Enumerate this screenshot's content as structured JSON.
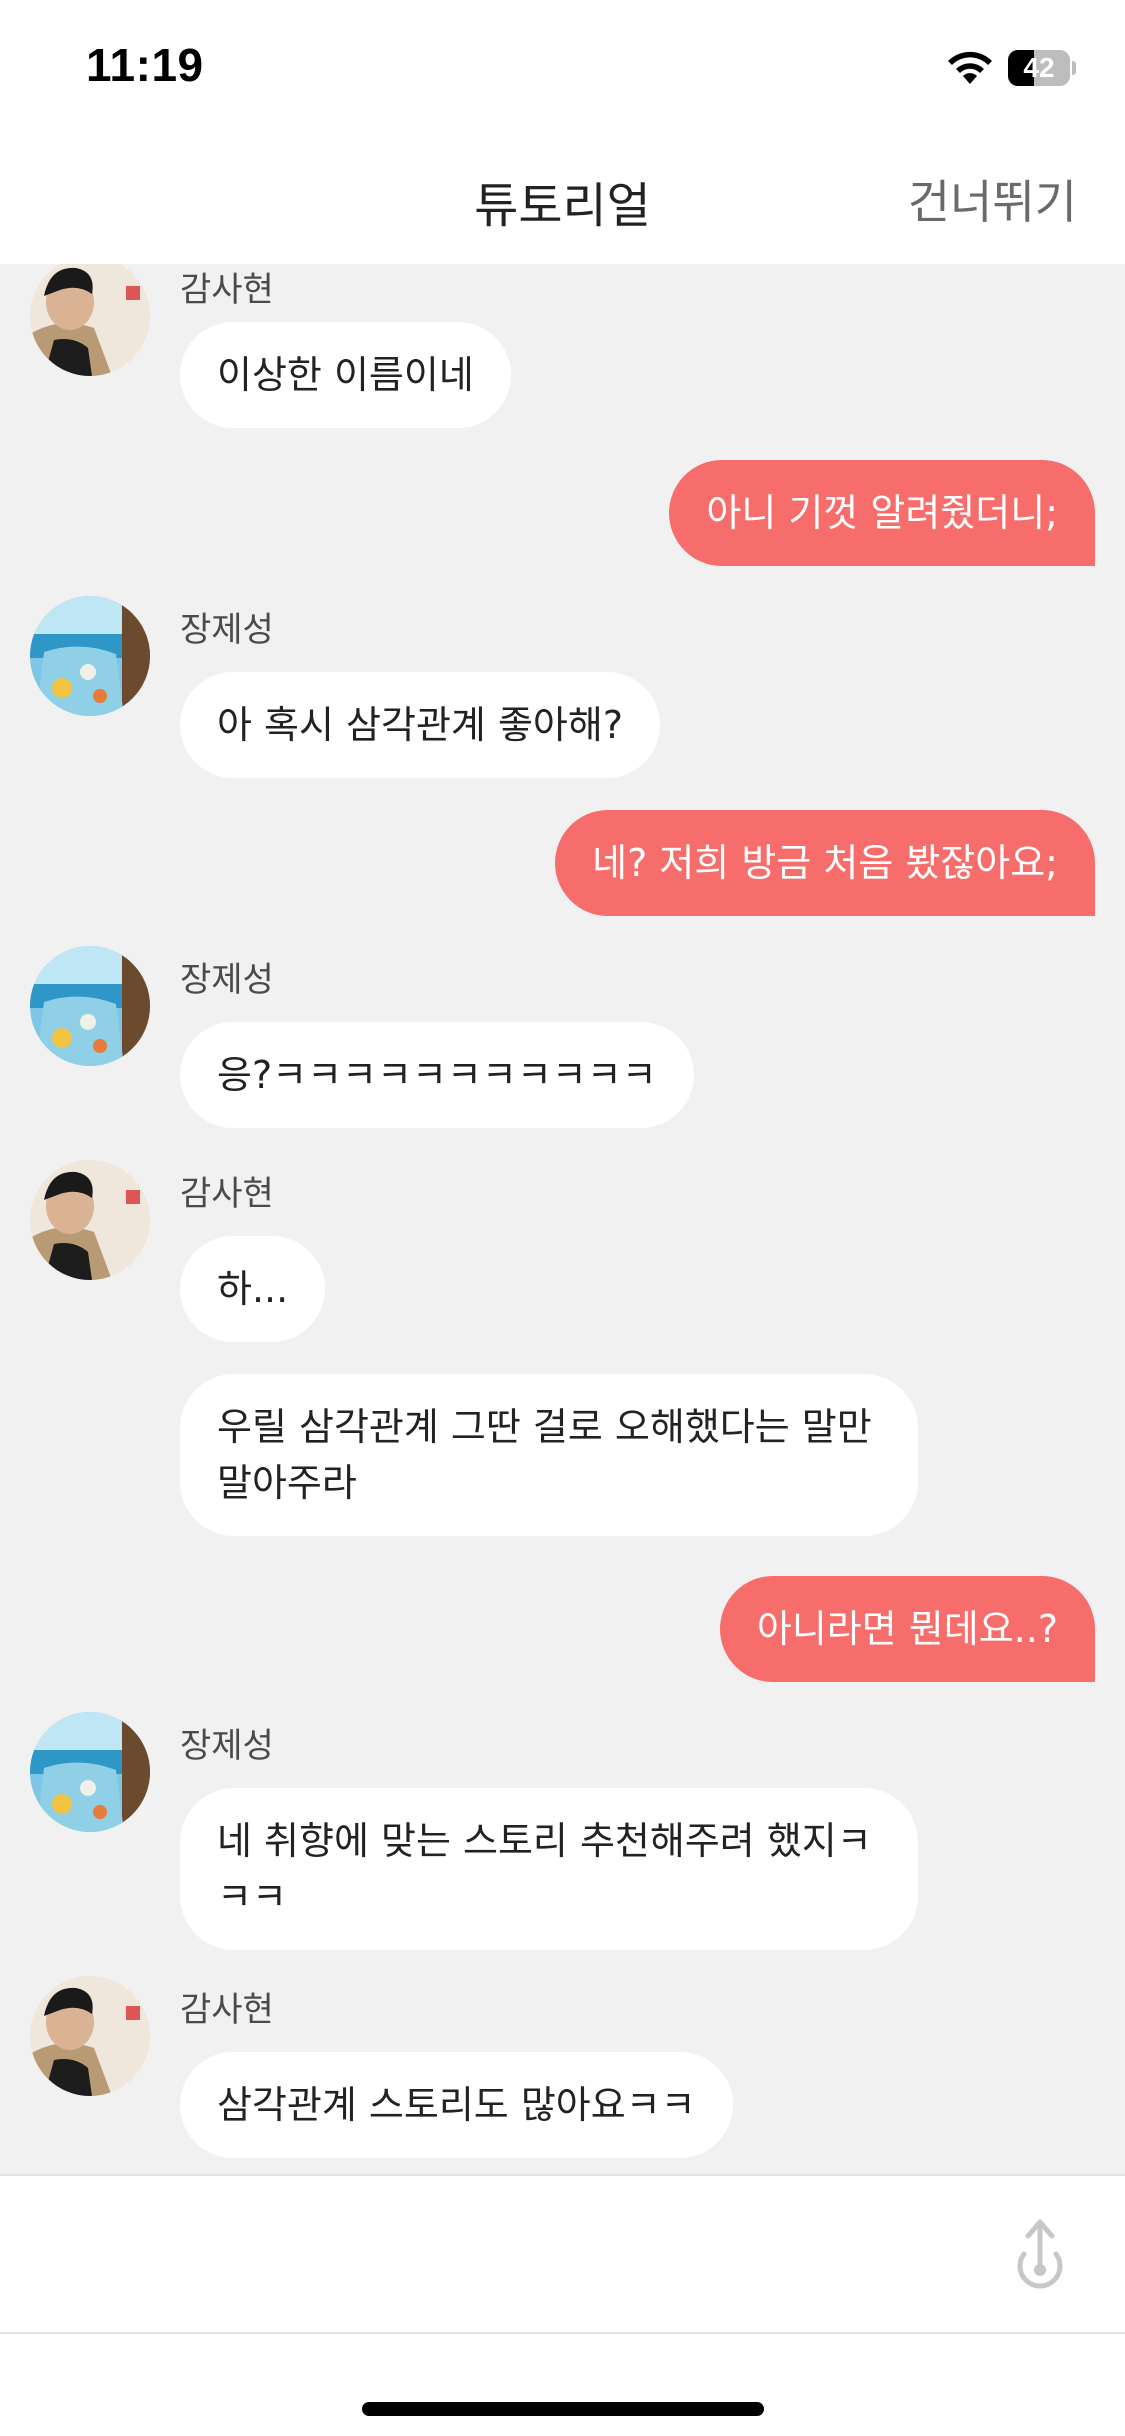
{
  "status_bar": {
    "time": "11:19",
    "battery_level": "42",
    "battery_fraction": 0.42
  },
  "header": {
    "title": "튜토리얼",
    "skip_label": "건너뛰기"
  },
  "messages": [
    {
      "side": "in",
      "sender": "감사현",
      "avatar": "man-portrait-avatar",
      "text": "이상한 이름이네"
    },
    {
      "side": "out",
      "text": "아니 기껏 알려줬더니;"
    },
    {
      "side": "in",
      "sender": "장제성",
      "avatar": "beach-shirt-avatar",
      "text": "아 혹시 삼각관계 좋아해?"
    },
    {
      "side": "out",
      "text": "네? 저희 방금 처음 봤잖아요;"
    },
    {
      "side": "in",
      "sender": "장제성",
      "avatar": "beach-shirt-avatar",
      "text": "응?ㅋㅋㅋㅋㅋㅋㅋㅋㅋㅋㅋ"
    },
    {
      "side": "in",
      "sender": "감사현",
      "avatar": "man-portrait-avatar",
      "text": "하..."
    },
    {
      "side": "in",
      "text": "우릴 삼각관계 그딴 걸로 오해했다는 말만 말아주라"
    },
    {
      "side": "out",
      "text": "아니라면 뭔데요..?"
    },
    {
      "side": "in",
      "sender": "장제성",
      "avatar": "beach-shirt-avatar",
      "text": "네 취향에 맞는 스토리 추천해주려 했지ㅋㅋㅋ"
    },
    {
      "side": "in",
      "sender": "감사현",
      "avatar": "man-portrait-avatar",
      "text": "삼각관계 스토리도 많아요ㅋㅋ"
    }
  ],
  "input": {
    "value": "",
    "placeholder": ""
  },
  "icons": {
    "send": "send-arrow-icon",
    "wifi": "wifi-icon",
    "battery": "battery-icon"
  },
  "colors": {
    "outgoing_bubble": "#f76d6b",
    "incoming_bubble": "#ffffff",
    "chat_background": "#f1f1f1"
  }
}
